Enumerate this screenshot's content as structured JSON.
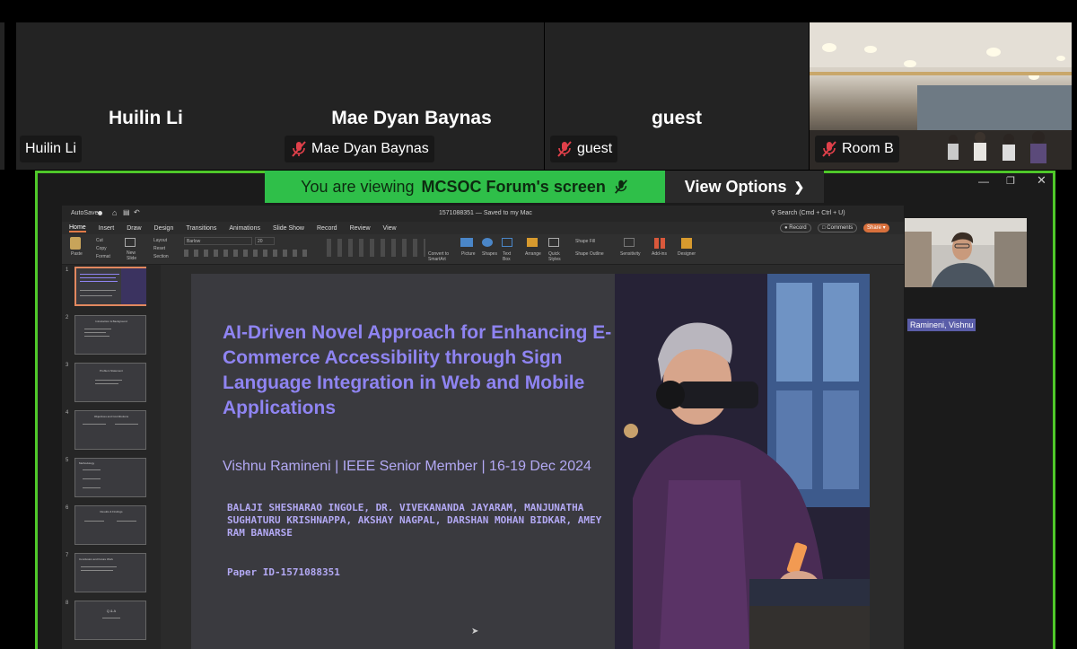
{
  "participants": [
    {
      "tile_name": "Huilin Li",
      "label": "Huilin Li",
      "muted": false
    },
    {
      "tile_name": "Mae Dyan Baynas",
      "label": "Mae Dyan Baynas",
      "muted": true
    },
    {
      "tile_name": "guest",
      "label": "guest",
      "muted": true
    },
    {
      "label": "Room B",
      "muted": true
    }
  ],
  "share": {
    "banner_prefix": "You are viewing",
    "banner_owner": "MCSOC Forum's screen",
    "view_options": "View Options"
  },
  "ppt": {
    "autosave": "AutoSave",
    "doc_title": "1571088351 — Saved to my Mac",
    "search_placeholder": "Search (Cmd + Ctrl + U)",
    "tabs": [
      "Home",
      "Insert",
      "Draw",
      "Design",
      "Transitions",
      "Animations",
      "Slide Show",
      "Record",
      "Review",
      "View"
    ],
    "record_label": "Record",
    "comments_label": "Comments",
    "share_label": "Share",
    "ribbon": {
      "paste": "Paste",
      "cut": "Cut",
      "copy": "Copy",
      "format": "Format",
      "new_slide": "New Slide",
      "layout": "Layout",
      "reset": "Reset",
      "section": "Section",
      "font": "Barlow",
      "size": "20",
      "convert": "Convert to SmartArt",
      "picture": "Picture",
      "shapes": "Shapes",
      "textbox": "Text Box",
      "arrange": "Arrange",
      "quick_styles": "Quick Styles",
      "shape_fill": "Shape Fill",
      "shape_outline": "Shape Outline",
      "sensitivity": "Sensitivity",
      "addins": "Add-ins",
      "designer": "Designer"
    },
    "thumbnails": [
      {
        "num": "1",
        "title": ""
      },
      {
        "num": "2",
        "title": "Introduction & Background"
      },
      {
        "num": "3",
        "title": "Problem Statement"
      },
      {
        "num": "4",
        "title": "Objectives and Contributions"
      },
      {
        "num": "5",
        "title": "Methodology"
      },
      {
        "num": "6",
        "title": "Results & Findings"
      },
      {
        "num": "7",
        "title": "Conclusion and Future Work"
      },
      {
        "num": "8",
        "title": "Q & A"
      }
    ]
  },
  "slide": {
    "title": "AI-Driven Novel Approach for Enhancing E-Commerce Accessibility through Sign Language Integration in Web and Mobile Applications",
    "subtitle": "Vishnu Ramineni | IEEE Senior Member | 16-19 Dec 2024",
    "authors": "BALAJI SHESHARAO INGOLE, DR. VIVEKANANDA JAYARAM, MANJUNATHA SUGHATURU KRISHNAPPA, AKSHAY NAGPAL, DARSHAN MOHAN BIDKAR, AMEY RAM BANARSE",
    "paper_id": "Paper ID-1571088351"
  },
  "presenter": {
    "label": "Ramineni, Vishnu"
  },
  "colors": {
    "share_border": "#4fc82a",
    "banner_bg": "#2fbf49",
    "title_purple": "#8f84f2",
    "mute_red": "#e0404a"
  }
}
